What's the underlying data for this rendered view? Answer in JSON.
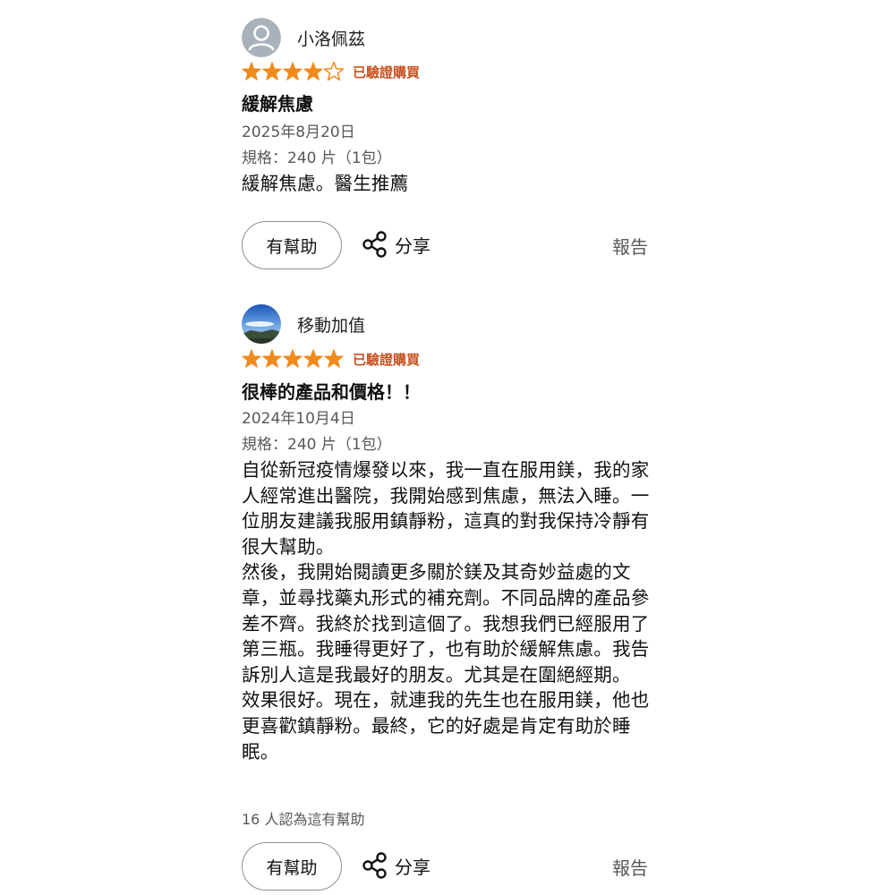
{
  "reviews": [
    {
      "username": "小洛佩茲",
      "avatar": "default-person-icon",
      "rating": 4,
      "max_rating": 5,
      "verified_label": "已驗證購買",
      "title": "緩解焦慮",
      "date": "2025年8月20日",
      "variant": "規格：240 片（1包）",
      "body": [
        "緩解焦慮。醫生推薦"
      ],
      "helpful_count_text": "",
      "helpful_button": "有幫助",
      "share_label": "分享",
      "report_label": "報告"
    },
    {
      "username": "移動加值",
      "avatar": "landscape-photo-avatar",
      "rating": 5,
      "max_rating": 5,
      "verified_label": "已驗證購買",
      "title": "很棒的產品和價格！！",
      "date": "2024年10月4日",
      "variant": "規格：240 片（1包）",
      "body": [
        "自從新冠疫情爆發以來，我一直在服用鎂，我的家人經常進出醫院，我開始感到焦慮，無法入睡。一位朋友建議我服用鎮靜粉，這真的對我保持冷靜有很大幫助。",
        "然後，我開始閱讀更多關於鎂及其奇妙益處的文章，並尋找藥丸形式的補充劑。不同品牌的產品參差不齊。我終於找到這個了。我想我們已經服用了第三瓶。我睡得更好了，也有助於緩解焦慮。我告訴別人這是我最好的朋友。尤其是在圍絕經期。",
        "效果很好。現在，就連我的先生也在服用鎂，他也更喜歡鎮靜粉。最終，它的好處是肯定有助於睡眠。"
      ],
      "helpful_count_text": "16 人認為這有幫助",
      "helpful_button": "有幫助",
      "share_label": "分享",
      "report_label": "報告"
    }
  ],
  "colors": {
    "star_filled": "#f08a1c",
    "star_empty": "#f08a1c",
    "verified": "#c7511f",
    "muted_text": "#565959",
    "button_border": "#8d9096"
  }
}
